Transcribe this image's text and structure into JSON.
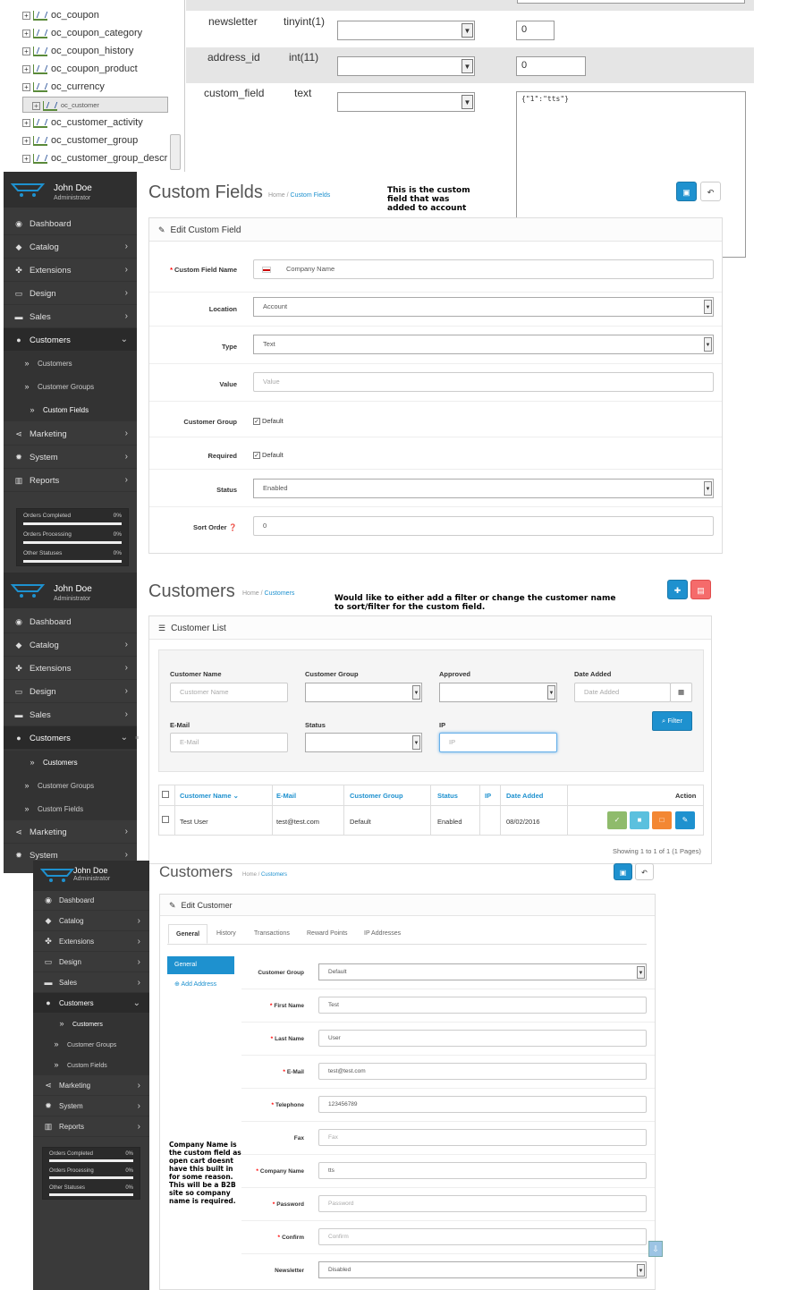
{
  "pma": {
    "tables": [
      {
        "name": "oc_coupon",
        "selected": false
      },
      {
        "name": "oc_coupon_category",
        "selected": false
      },
      {
        "name": "oc_coupon_history",
        "selected": false
      },
      {
        "name": "oc_coupon_product",
        "selected": false
      },
      {
        "name": "oc_currency",
        "selected": false
      },
      {
        "name": "oc_customer",
        "selected": true
      },
      {
        "name": "oc_customer_activity",
        "selected": false
      },
      {
        "name": "oc_customer_group",
        "selected": false
      },
      {
        "name": "oc_customer_group_descr",
        "selected": false
      }
    ],
    "rows": [
      {
        "field": "newsletter",
        "type": "tinyint(1)",
        "value": "0"
      },
      {
        "field": "address_id",
        "type": "int(11)",
        "value": "0"
      },
      {
        "field": "custom_field",
        "type": "text",
        "value": "{\"1\":\"tts\"}"
      }
    ]
  },
  "user": {
    "name": "John Doe",
    "role": "Administrator"
  },
  "nav": {
    "dashboard": "Dashboard",
    "catalog": "Catalog",
    "extensions": "Extensions",
    "design": "Design",
    "sales": "Sales",
    "customers": "Customers",
    "sub_customers": "Customers",
    "sub_groups": "Customer Groups",
    "sub_fields": "Custom Fields",
    "marketing": "Marketing",
    "system": "System",
    "reports": "Reports"
  },
  "stats": [
    {
      "label": "Orders Completed",
      "pct": "0%",
      "fraction": 0
    },
    {
      "label": "Orders Processing",
      "pct": "0%",
      "fraction": 0
    },
    {
      "label": "Other Statuses",
      "pct": "0%",
      "fraction": 0
    }
  ],
  "cf": {
    "title": "Custom Fields",
    "crumb_home": "Home",
    "crumb_page": "Custom Fields",
    "note": "This is the custom field that was added to account",
    "panel_title": "Edit Custom Field",
    "labels": {
      "name": "Custom Field Name",
      "location": "Location",
      "type": "Type",
      "value": "Value",
      "group": "Customer Group",
      "required": "Required",
      "status": "Status",
      "sort": "Sort Order"
    },
    "name_value": "Company Name",
    "location_value": "Account",
    "type_value": "Text",
    "value_placeholder": "Value",
    "group_option": "Default",
    "required_option": "Default",
    "status_value": "Enabled",
    "sort_value": "0"
  },
  "cl": {
    "title": "Customers",
    "crumb_home": "Home",
    "crumb_page": "Customers",
    "note": "Would like to either add a filter or change the customer name to sort/filter for the custom field.",
    "panel_title": "Customer List",
    "filter": {
      "name_label": "Customer Name",
      "name_ph": "Customer Name",
      "group_label": "Customer Group",
      "approved_label": "Approved",
      "date_label": "Date Added",
      "date_ph": "Date Added",
      "email_label": "E-Mail",
      "email_ph": "E-Mail",
      "status_label": "Status",
      "ip_label": "IP",
      "ip_ph": "IP",
      "button": "Filter"
    },
    "columns": {
      "name": "Customer Name",
      "email": "E-Mail",
      "group": "Customer Group",
      "status": "Status",
      "ip": "IP",
      "date": "Date Added",
      "action": "Action"
    },
    "row": {
      "name": "Test User",
      "email": "test@test.com",
      "group": "Default",
      "status": "Enabled",
      "ip": "",
      "date": "08/02/2016"
    },
    "pagination": "Showing 1 to 1 of 1 (1 Pages)"
  },
  "ec": {
    "title": "Customers",
    "crumb_home": "Home",
    "crumb_page": "Customers",
    "panel_title": "Edit Customer",
    "tabs": [
      "General",
      "History",
      "Transactions",
      "Reward Points",
      "IP Addresses"
    ],
    "vtab": "General",
    "add_address": "Add Address",
    "note": "Company Name is the custom field as open cart doesnt have this built in for some reason. This will be a B2B site so company name is required.",
    "fields": {
      "group_label": "Customer Group",
      "group_value": "Default",
      "first_label": "First Name",
      "first_value": "Test",
      "last_label": "Last Name",
      "last_value": "User",
      "email_label": "E-Mail",
      "email_value": "test@test.com",
      "tel_label": "Telephone",
      "tel_value": "123456789",
      "fax_label": "Fax",
      "fax_ph": "Fax",
      "company_label": "Company Name",
      "company_value": "tts",
      "password_label": "Password",
      "password_ph": "Password",
      "confirm_label": "Confirm",
      "confirm_ph": "Confirm",
      "newsletter_label": "Newsletter",
      "newsletter_value": "Disabled"
    }
  },
  "colors": {
    "primary": "#1e91cf",
    "danger": "#f56b6b",
    "success": "#8fbb6c",
    "warning": "#f38733",
    "sidebar": "#3a3a3a"
  }
}
